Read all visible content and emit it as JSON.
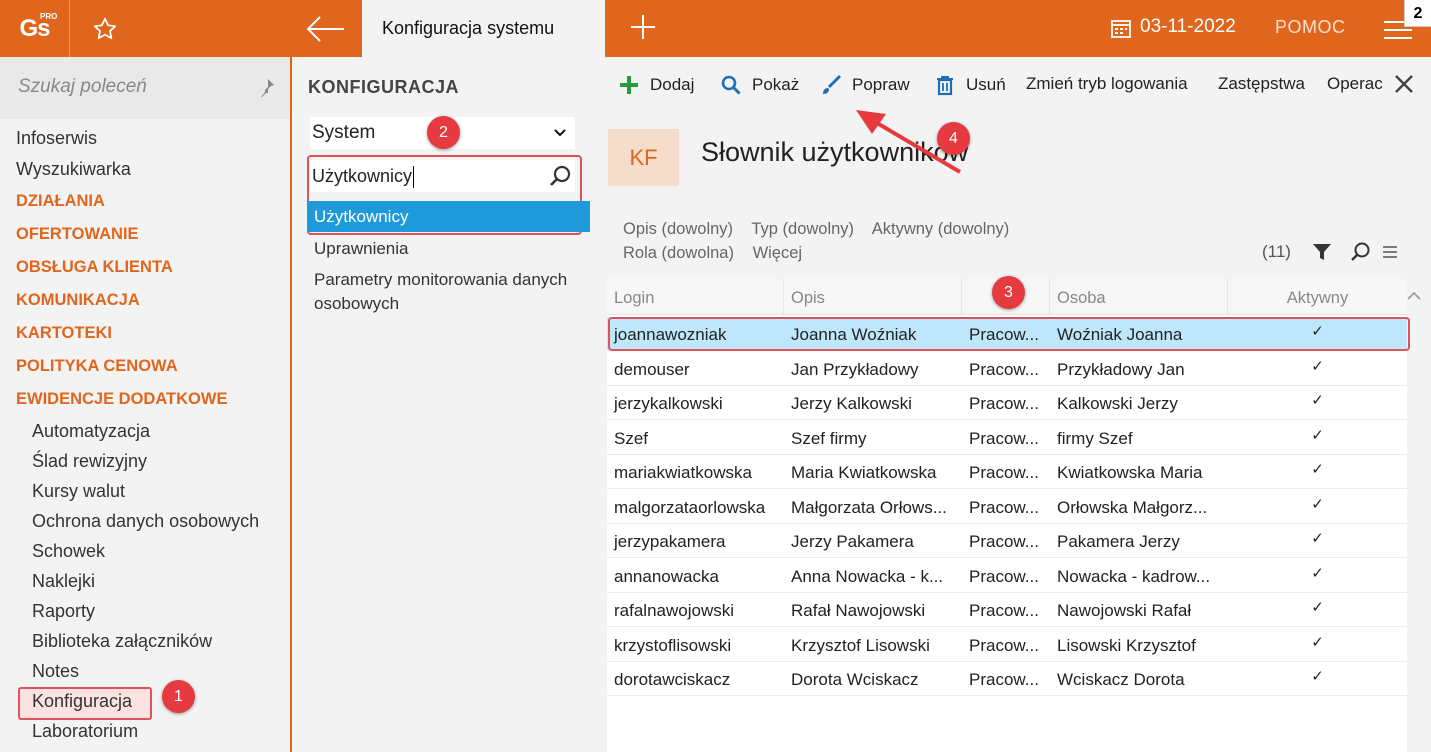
{
  "app": {
    "logo_text": "Gs",
    "logo_superscript": "PRO",
    "active_tab": "Konfiguracja systemu",
    "date": "03-11-2022",
    "help": "POMOC",
    "corner_badge": "2"
  },
  "sidebar": {
    "search_placeholder": "Szukaj poleceń",
    "items": [
      {
        "label": "Infoserwis",
        "type": "link"
      },
      {
        "label": "Wyszukiwarka",
        "type": "link"
      },
      {
        "label": "DZIAŁANIA",
        "type": "category"
      },
      {
        "label": "OFERTOWANIE",
        "type": "category"
      },
      {
        "label": "OBSŁUGA KLIENTA",
        "type": "category"
      },
      {
        "label": "KOMUNIKACJA",
        "type": "category"
      },
      {
        "label": "KARTOTEKI",
        "type": "category"
      },
      {
        "label": "POLITYKA CENOWA",
        "type": "category"
      },
      {
        "label": "EWIDENCJE DODATKOWE",
        "type": "category"
      },
      {
        "label": "Automatyzacja",
        "type": "sub"
      },
      {
        "label": "Ślad rewizyjny",
        "type": "sub"
      },
      {
        "label": "Kursy walut",
        "type": "sub"
      },
      {
        "label": "Ochrona danych osobowych",
        "type": "sub"
      },
      {
        "label": "Schowek",
        "type": "sub"
      },
      {
        "label": "Naklejki",
        "type": "sub"
      },
      {
        "label": "Raporty",
        "type": "sub"
      },
      {
        "label": "Biblioteka załączników",
        "type": "sub"
      },
      {
        "label": "Notes",
        "type": "sub"
      },
      {
        "label": "Konfiguracja",
        "type": "sub-selected"
      },
      {
        "label": "Laboratorium",
        "type": "sub"
      }
    ]
  },
  "config": {
    "title": "KONFIGURACJA",
    "section_select": "System",
    "search_value": "Użytkownicy",
    "result_selected": "Użytkownicy",
    "result_items": [
      "Uprawnienia",
      "Parametry monitorowania danych osobowych"
    ]
  },
  "toolbar": {
    "add": "Dodaj",
    "show": "Pokaż",
    "edit": "Popraw",
    "delete": "Usuń",
    "login_mode": "Zmień tryb logowania",
    "substitutes": "Zastępstwa",
    "operations": "Operac"
  },
  "page": {
    "badge": "KF",
    "title": "Słownik użytkowników"
  },
  "filters": {
    "row1": [
      "Opis (dowolny)",
      "Typ (dowolny)",
      "Aktywny (dowolny)"
    ],
    "row2": [
      "Rola (dowolna)",
      "Więcej"
    ],
    "count": "(11)"
  },
  "table": {
    "headers": [
      "Login",
      "Opis",
      "",
      "Osoba",
      "Aktywny"
    ],
    "rows": [
      [
        "joannawozniak",
        "Joanna Woźniak",
        "Pracow...",
        "Woźniak Joanna",
        "✓"
      ],
      [
        "demouser",
        "Jan Przykładowy",
        "Pracow...",
        "Przykładowy Jan",
        "✓"
      ],
      [
        "jerzykalkowski",
        "Jerzy Kalkowski",
        "Pracow...",
        "Kalkowski Jerzy",
        "✓"
      ],
      [
        "Szef",
        "Szef firmy",
        "Pracow...",
        "firmy Szef",
        "✓"
      ],
      [
        "mariakwiatkowska",
        "Maria Kwiatkowska",
        "Pracow...",
        "Kwiatkowska Maria",
        "✓"
      ],
      [
        "malgorzataorlowska",
        "Małgorzata Orłows...",
        "Pracow...",
        "Orłowska Małgorz...",
        "✓"
      ],
      [
        "jerzypakamera",
        "Jerzy Pakamera",
        "Pracow...",
        "Pakamera Jerzy",
        "✓"
      ],
      [
        "annanowacka",
        "Anna Nowacka - k...",
        "Pracow...",
        "Nowacka - kadrow...",
        "✓"
      ],
      [
        "rafalnawojowski",
        "Rafał Nawojowski",
        "Pracow...",
        "Nawojowski Rafał",
        "✓"
      ],
      [
        "krzystoflisowski",
        "Krzysztof Lisowski",
        "Pracow...",
        "Lisowski Krzysztof",
        "✓"
      ],
      [
        "dorotawciskacz",
        "Dorota Wciskacz",
        "Pracow...",
        "Wciskacz Dorota",
        "✓"
      ]
    ]
  },
  "annotations": [
    "1",
    "2",
    "3",
    "4"
  ],
  "colors": {
    "accent": "#e1661d",
    "highlight": "#1e9adb",
    "selected_row": "#bfe7fb",
    "annotation": "#e43a40"
  }
}
